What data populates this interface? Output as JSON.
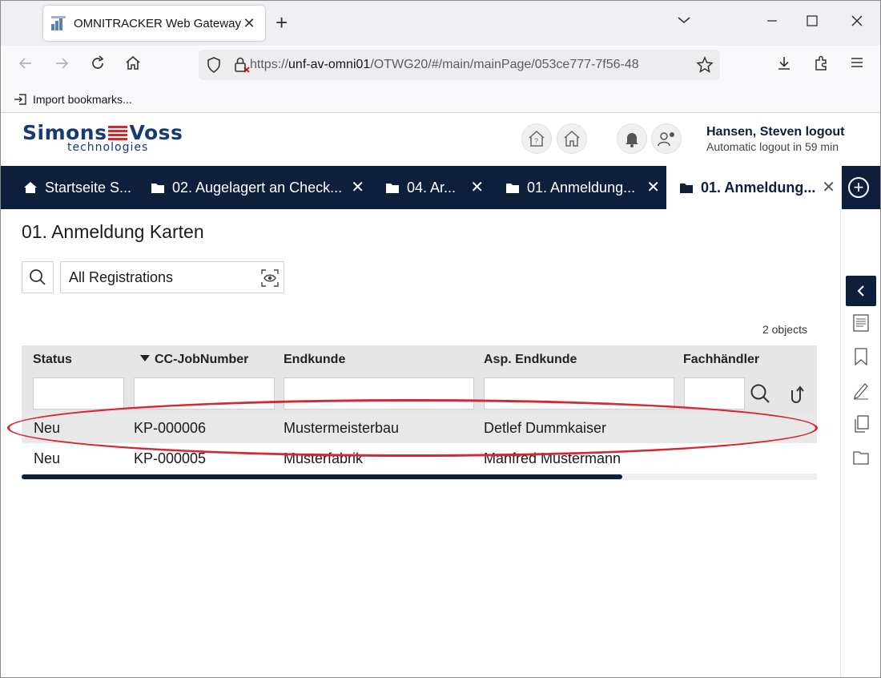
{
  "browser": {
    "tab_title": "OMNITRACKER Web Gateway",
    "tab_close": "✕",
    "new_tab": "+",
    "url_prefix": "https://",
    "url_host": "unf-av-omni01",
    "url_path": "/OTWG20/#/main/mainPage/053ce777-7f56-48",
    "bookmark_label": "Import bookmarks..."
  },
  "app_header": {
    "logo_left": "Simons",
    "logo_right": "Voss",
    "logo_sub": "technologies",
    "user_name": "Hansen, Steven logout",
    "logout_info": "Automatic logout in 59 min"
  },
  "app_tabs": [
    {
      "label": "Startseite S...",
      "icon": "home-icon"
    },
    {
      "label": "02. Augelagert an Check...",
      "icon": "folder-icon"
    },
    {
      "label": "04. Ar...",
      "icon": "folder-icon"
    },
    {
      "label": "01. Anmeldung...",
      "icon": "folder-icon"
    },
    {
      "label": "01. Anmeldung...",
      "icon": "folder-icon",
      "active": true
    }
  ],
  "page": {
    "title": "01. Anmeldung Karten",
    "view_selector": "All Registrations",
    "object_count": "2 objects"
  },
  "grid": {
    "columns": [
      "Status",
      "CC-JobNumber",
      "Endkunde",
      "Asp. Endkunde",
      "Fachhändler"
    ],
    "sort_column": "CC-JobNumber",
    "sort_direction": "descending",
    "rows": [
      {
        "status": "Neu",
        "job": "KP-000006",
        "endkunde": "Mustermeisterbau",
        "asp": "Detlef Dummkaiser",
        "fach": ""
      },
      {
        "status": "Neu",
        "job": "KP-000005",
        "endkunde": "Musterfabrik",
        "asp": "Manfred Mustermann",
        "fach": ""
      }
    ]
  },
  "colors": {
    "navy": "#0e1f3b",
    "annotation_red": "#d7282f",
    "logo_blue": "#173a74"
  }
}
